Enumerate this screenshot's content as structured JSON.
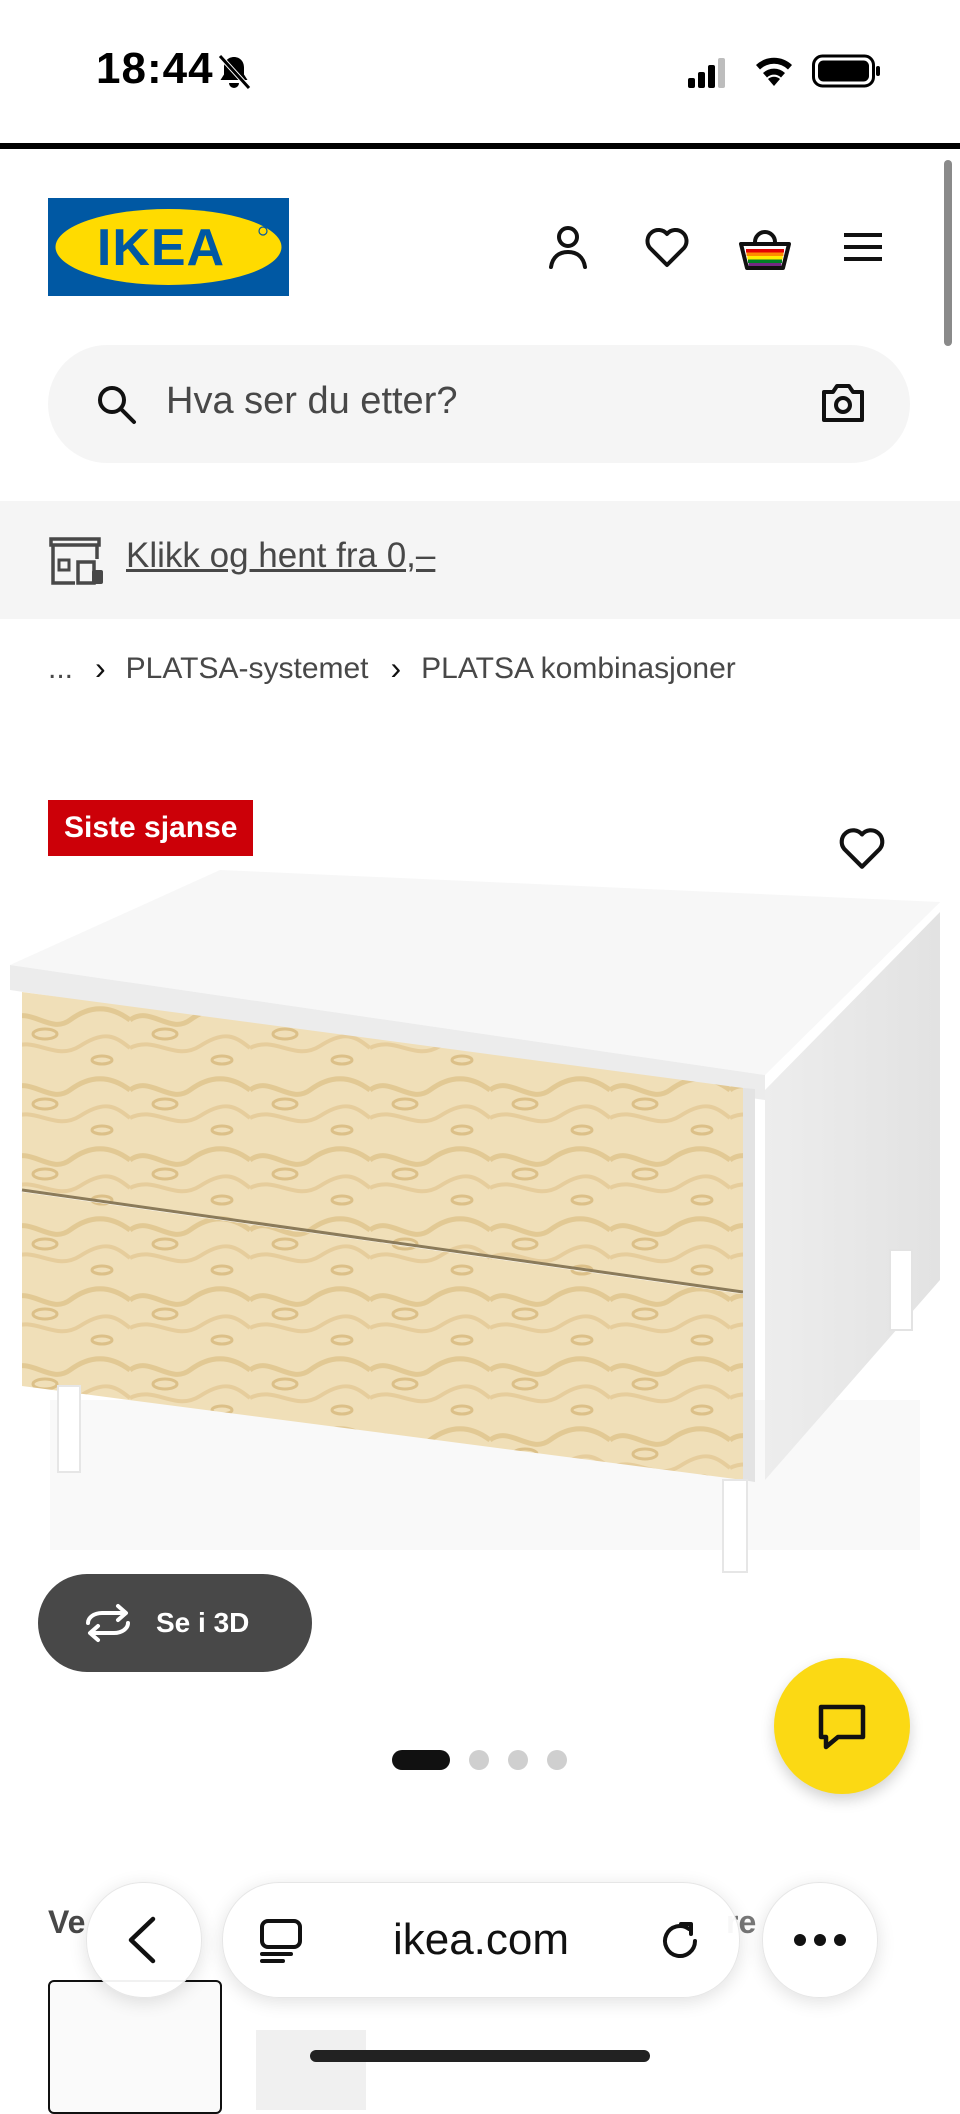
{
  "status_bar": {
    "time": "18:44",
    "icons": [
      "bell-slash-icon",
      "cellular-signal-icon",
      "wifi-icon",
      "battery-icon"
    ]
  },
  "header": {
    "logo_text": "IKEA",
    "icons": [
      "account-icon",
      "wishlist-icon",
      "basket-icon",
      "menu-icon"
    ],
    "brand_colors": {
      "blue": "#0058a3",
      "yellow": "#ffdb00"
    }
  },
  "search": {
    "placeholder": "Hva ser du etter?",
    "icons": [
      "search-icon",
      "camera-icon"
    ]
  },
  "banner": {
    "text": "Klikk og hent fra 0,–",
    "icon": "store-icon"
  },
  "breadcrumb": {
    "items": [
      "...",
      "PLATSA-systemet",
      "PLATSA kombinasjoner"
    ]
  },
  "product": {
    "badge": "Siste sjanse",
    "badge_color": "#cc0008",
    "see_3d_label": "Se i 3D",
    "carousel": {
      "total": 4,
      "active": 1
    },
    "chat_button_color": "#fbd914"
  },
  "below_fold": {
    "heading_start": "Ve",
    "heading_end": "re"
  },
  "browser": {
    "url": "ikea.com",
    "icons": [
      "back-icon",
      "tabs-icon",
      "reload-icon",
      "more-icon"
    ]
  }
}
